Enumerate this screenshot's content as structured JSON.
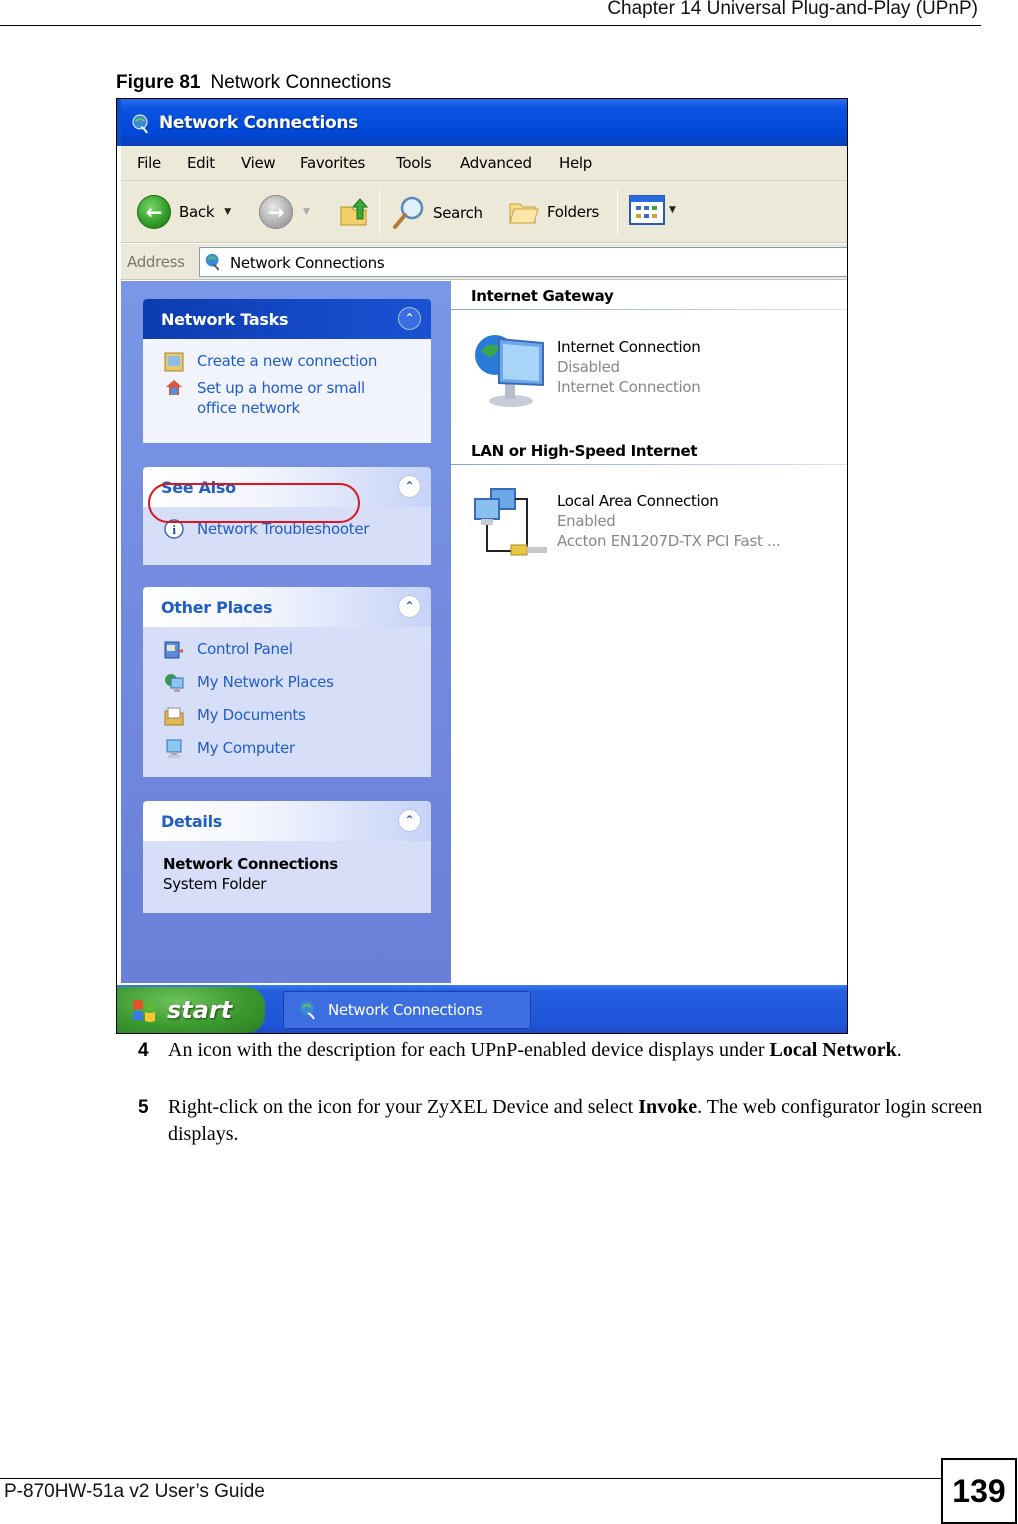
{
  "document": {
    "chapter_header": "Chapter 14 Universal Plug-and-Play (UPnP)",
    "figure_label": "Figure 81",
    "figure_title": "Network Connections",
    "footer_title": "P-870HW-51a v2 User’s Guide",
    "page_number": "139"
  },
  "window": {
    "title": "Network Connections",
    "menu": [
      "File",
      "Edit",
      "View",
      "Favorites",
      "Tools",
      "Advanced",
      "Help"
    ],
    "toolbar": {
      "back_label": "Back",
      "search_label": "Search",
      "folders_label": "Folders"
    },
    "address": {
      "label": "Address",
      "value": "Network Connections"
    },
    "task_pane": {
      "network_tasks": {
        "title": "Network Tasks",
        "items": [
          "Create a new connection",
          "Set up a home or small office network"
        ]
      },
      "see_also": {
        "title": "See Also",
        "items": [
          "Network Troubleshooter"
        ]
      },
      "other_places": {
        "title": "Other Places",
        "items": [
          "Control Panel",
          "My Network Places",
          "My Documents",
          "My Computer"
        ],
        "highlighted": "My Network Places"
      },
      "details": {
        "title": "Details",
        "name": "Network Connections",
        "type": "System Folder"
      }
    },
    "content": {
      "groups": [
        {
          "header": "Internet Gateway",
          "items": [
            {
              "name": "Internet Connection",
              "status": "Disabled",
              "description": "Internet Connection"
            }
          ]
        },
        {
          "header": "LAN or High-Speed Internet",
          "items": [
            {
              "name": "Local Area Connection",
              "status": "Enabled",
              "description": "Accton EN1207D-TX PCI Fast ..."
            }
          ]
        }
      ]
    },
    "taskbar": {
      "start_label": "start",
      "tasks": [
        "Network Connections"
      ]
    }
  },
  "steps": [
    {
      "number": "4",
      "text_before": "An icon with the description for each UPnP-enabled device displays under ",
      "bold": "Local Network",
      "text_after": "."
    },
    {
      "number": "5",
      "text_before": "Right-click on the icon for your ZyXEL Device and select ",
      "bold": "Invoke",
      "text_after": ". The web configurator login screen displays."
    }
  ],
  "colors": {
    "highlight_ring": "#e0141c",
    "xp_title_blue": "#0048d8",
    "task_link_blue": "#215dc6"
  }
}
